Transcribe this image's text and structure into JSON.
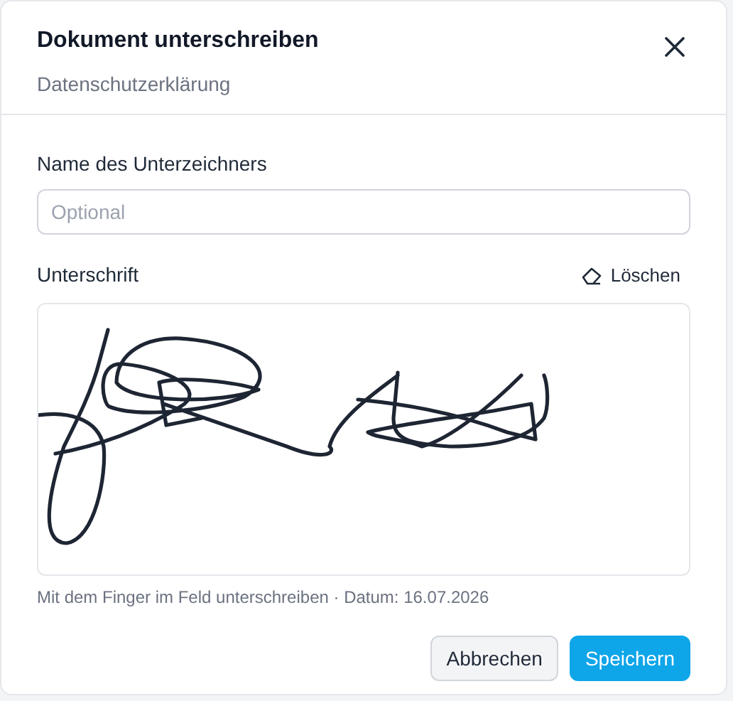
{
  "dialog": {
    "title": "Dokument unterschreiben",
    "subtitle": "Datenschutzerklärung"
  },
  "name_field": {
    "label": "Name des Unterzeichners",
    "placeholder": "Optional"
  },
  "signature": {
    "label": "Unterschrift",
    "clear_button": "Löschen",
    "hint": "Mit dem Finger im Feld unterschreiben · Datum: 16.07.2026"
  },
  "buttons": [
    {
      "label": "Abbrechen",
      "kind": "secondary"
    },
    {
      "label": "Speichern",
      "kind": "primary"
    }
  ]
}
